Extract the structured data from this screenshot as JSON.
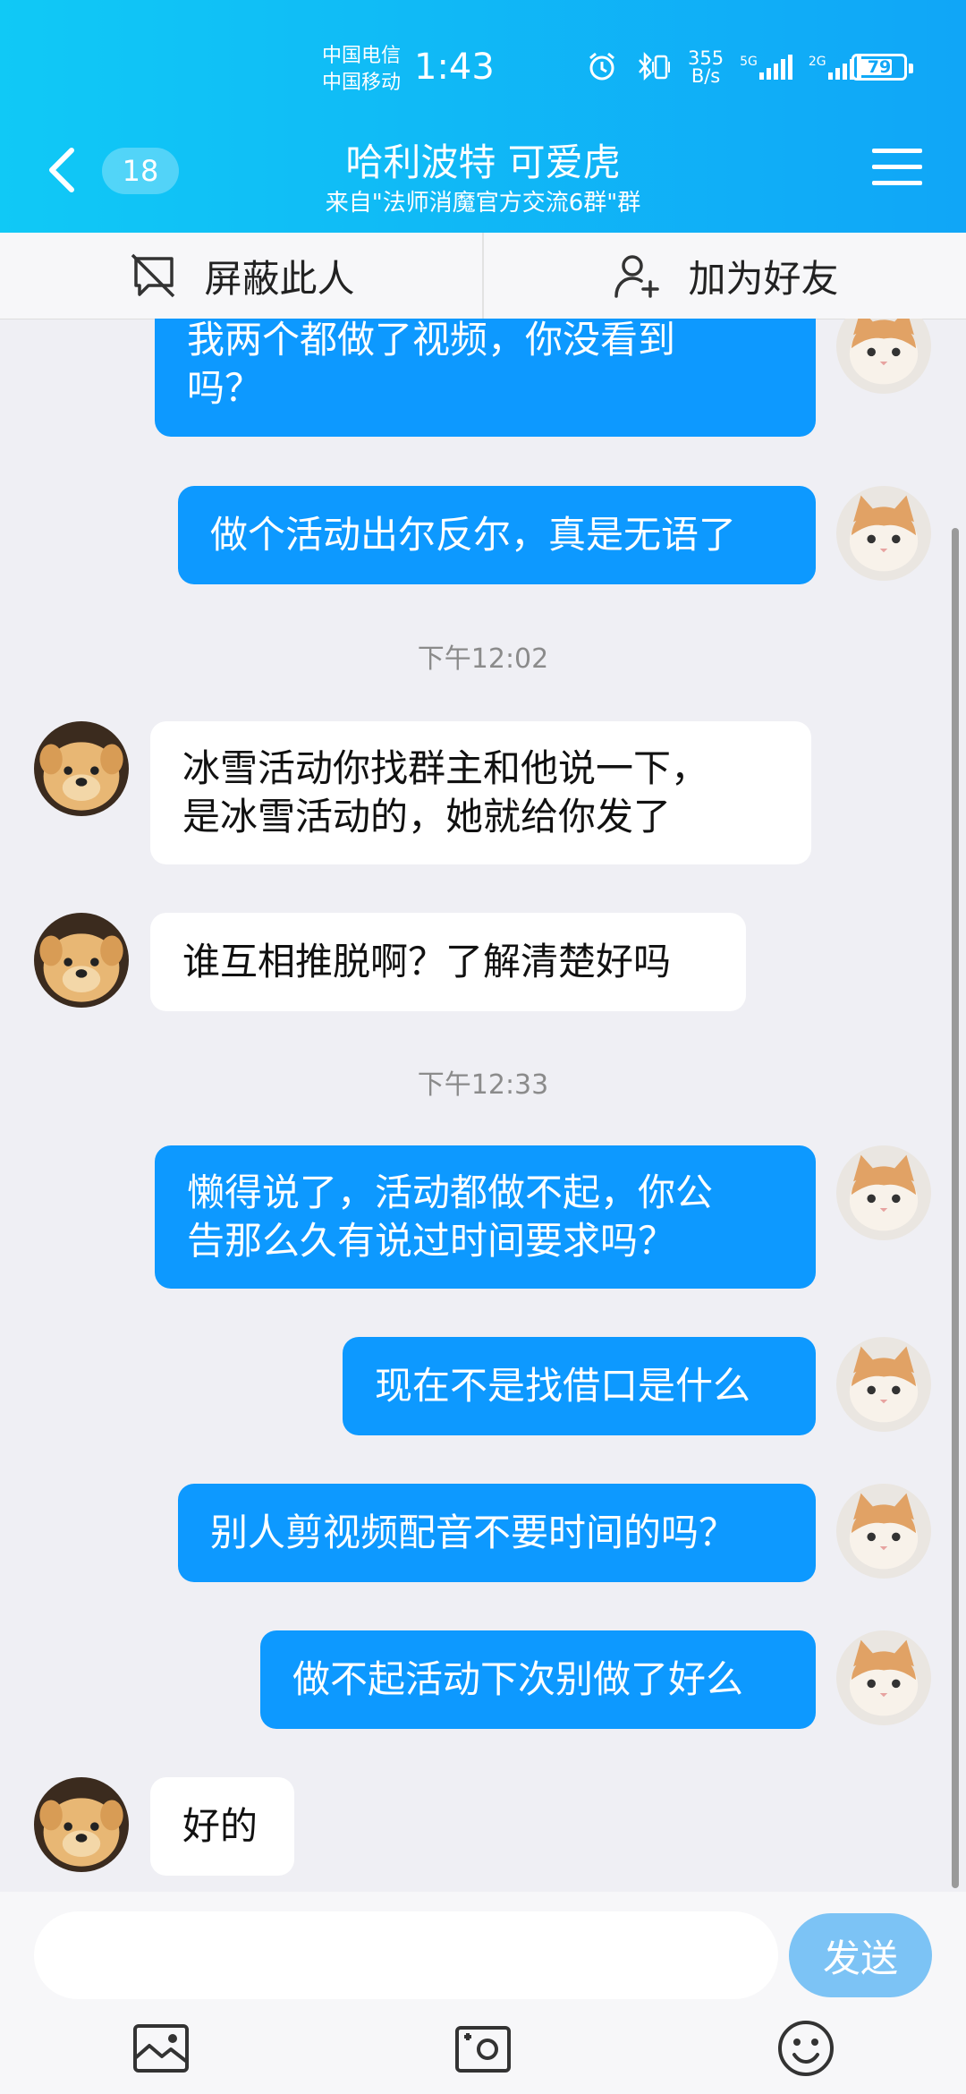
{
  "status_bar": {
    "carrier1": "中国电信",
    "carrier2": "中国移动",
    "time": "1:43",
    "net_speed_top": "355",
    "net_speed_bottom": "B/s",
    "sig1": "5G",
    "sig2": "2G",
    "battery": "79"
  },
  "header": {
    "unread_count": "18",
    "title": "哈利波特 可爱虎",
    "subtitle": "来自\"法师消魔官方交流6群\"群"
  },
  "action_bar": {
    "block_label": "屏蔽此人",
    "add_friend_label": "加为好友"
  },
  "messages": [
    {
      "from": "me",
      "lines": [
        "我两个都做了视频，你没看到",
        "吗？"
      ]
    },
    {
      "from": "me",
      "lines": [
        "做个活动出尔反尔，真是无语了"
      ]
    },
    {
      "time": "下午12:02"
    },
    {
      "from": "other",
      "lines": [
        "冰雪活动你找群主和他说一下，",
        "是冰雪活动的，她就给你发了"
      ]
    },
    {
      "from": "other",
      "lines": [
        "谁互相推脱啊？了解清楚好吗"
      ]
    },
    {
      "time": "下午12:33"
    },
    {
      "from": "me",
      "lines": [
        "懒得说了，活动都做不起，你公",
        "告那么久有说过时间要求吗？"
      ]
    },
    {
      "from": "me",
      "lines": [
        "现在不是找借口是什么"
      ]
    },
    {
      "from": "me",
      "lines": [
        "别人剪视频配音不要时间的吗？"
      ]
    },
    {
      "from": "me",
      "lines": [
        "做不起活动下次别做了好么"
      ]
    },
    {
      "from": "other",
      "lines": [
        "好的"
      ]
    }
  ],
  "input": {
    "value": "",
    "send_label": "发送"
  },
  "icons": {
    "back": "chevron-left-icon",
    "menu": "hamburger-menu-icon",
    "block": "block-user-icon",
    "add_friend": "add-friend-icon",
    "photo": "photo-icon",
    "camera": "camera-icon",
    "emoji": "emoji-icon"
  },
  "colors": {
    "header_start": "#10c9f6",
    "header_end": "#10a6f7",
    "my_bubble": "#0d99ff",
    "other_bubble": "#ffffff",
    "send_button": "#7cc3f5"
  }
}
